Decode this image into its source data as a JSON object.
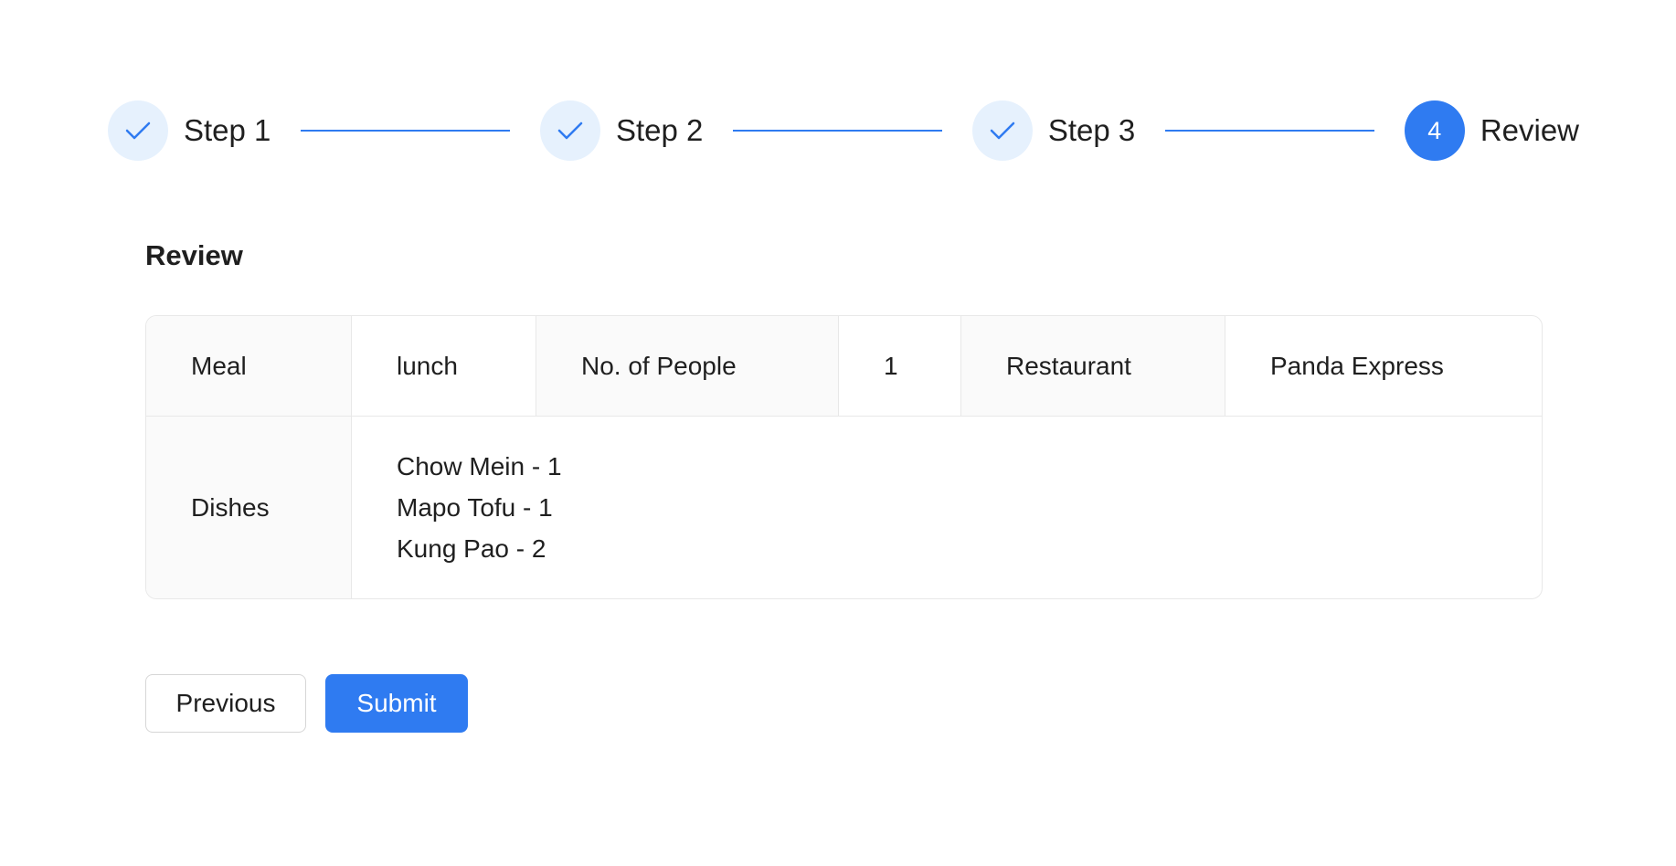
{
  "steps": [
    {
      "label": "Step 1",
      "status": "done",
      "icon": "check-icon"
    },
    {
      "label": "Step 2",
      "status": "done",
      "icon": "check-icon"
    },
    {
      "label": "Step 3",
      "status": "done",
      "icon": "check-icon"
    },
    {
      "label": "Review",
      "status": "current",
      "number": "4"
    }
  ],
  "review": {
    "title": "Review",
    "meal_label": "Meal",
    "meal_value": "lunch",
    "people_label": "No. of People",
    "people_value": "1",
    "restaurant_label": "Restaurant",
    "restaurant_value": "Panda Express",
    "dishes_label": "Dishes",
    "dishes": [
      "Chow Mein - 1",
      "Mapo Tofu - 1",
      "Kung Pao - 2"
    ]
  },
  "buttons": {
    "previous": "Previous",
    "submit": "Submit"
  },
  "colors": {
    "accent": "#2f7bf1",
    "step_done_bg": "#e6f1fd",
    "label_bg": "#fafafa",
    "border": "#e8e8e8"
  }
}
